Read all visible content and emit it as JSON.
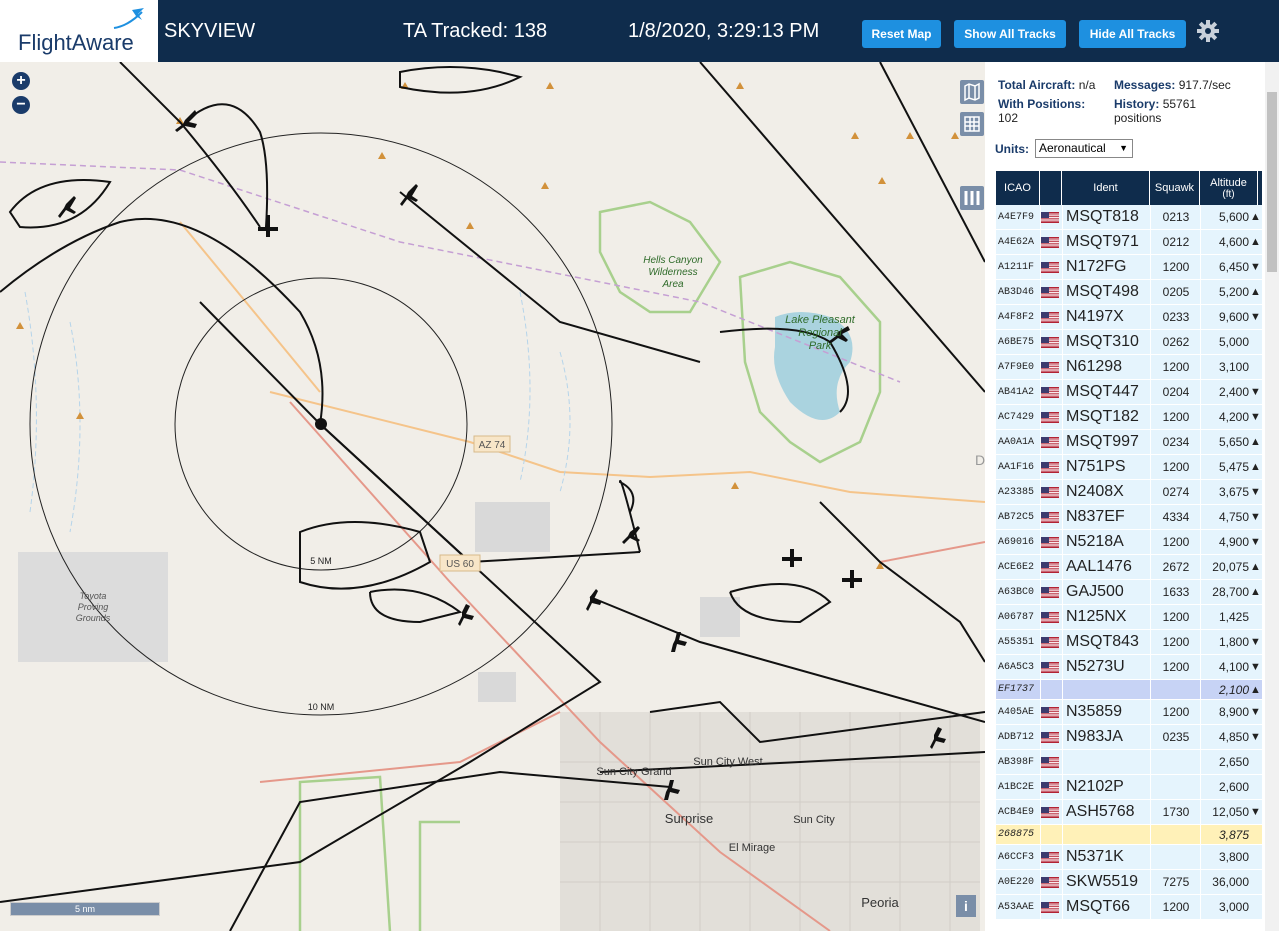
{
  "header": {
    "logo": "FlightAware",
    "title": "SKYVIEW",
    "tracked": "TA Tracked: 138",
    "clock": "1/8/2020, 3:29:13 PM",
    "buttons": {
      "reset": "Reset Map",
      "show_all": "Show All Tracks",
      "hide_all": "Hide All Tracks"
    }
  },
  "map": {
    "labels": {
      "hells_canyon": [
        "Hells Canyon",
        "Wilderness",
        "Area"
      ],
      "lake_pleasant": [
        "Lake Pleasant",
        "Regional",
        "Park"
      ],
      "toyota": [
        "Toyota",
        "Proving",
        "Grounds"
      ],
      "az74": "AZ 74",
      "us60": "US 60",
      "ring5": "5 NM",
      "ring10": "10 NM",
      "sun_city_grand": "Sun City Grand",
      "sun_city_west": "Sun City West",
      "surprise": "Surprise",
      "sun_city": "Sun City",
      "el_mirage": "El Mirage",
      "peoria": "Peoria",
      "d": "D"
    },
    "scale": "5 nm",
    "info": "i"
  },
  "panel": {
    "total_aircraft_label": "Total Aircraft:",
    "total_aircraft_value": "n/a",
    "messages_label": "Messages:",
    "messages_value": "917.7/sec",
    "with_positions_label": "With Positions:",
    "with_positions_value": "102",
    "history_label": "History:",
    "history_value": "55761",
    "history_unit": "positions",
    "units_label": "Units:",
    "units_value": "Aeronautical",
    "columns": {
      "icao": "ICAO",
      "ident": "Ident",
      "squawk": "Squawk",
      "altitude": "Altitude",
      "altitude_unit": "(ft)"
    },
    "rows": [
      {
        "icao": "A4E7F9",
        "ident": "MSQT818",
        "squawk": "0213",
        "alt": "5,600",
        "trend": "▲"
      },
      {
        "icao": "A4E62A",
        "ident": "MSQT971",
        "squawk": "0212",
        "alt": "4,600",
        "trend": "▲"
      },
      {
        "icao": "A1211F",
        "ident": "N172FG",
        "squawk": "1200",
        "alt": "6,450",
        "trend": "▼"
      },
      {
        "icao": "AB3D46",
        "ident": "MSQT498",
        "squawk": "0205",
        "alt": "5,200",
        "trend": "▲"
      },
      {
        "icao": "A4F8F2",
        "ident": "N4197X",
        "squawk": "0233",
        "alt": "9,600",
        "trend": "▼"
      },
      {
        "icao": "A6BE75",
        "ident": "MSQT310",
        "squawk": "0262",
        "alt": "5,000",
        "trend": ""
      },
      {
        "icao": "A7F9E0",
        "ident": "N61298",
        "squawk": "1200",
        "alt": "3,100",
        "trend": ""
      },
      {
        "icao": "AB41A2",
        "ident": "MSQT447",
        "squawk": "0204",
        "alt": "2,400",
        "trend": "▼"
      },
      {
        "icao": "AC7429",
        "ident": "MSQT182",
        "squawk": "1200",
        "alt": "4,200",
        "trend": "▼"
      },
      {
        "icao": "AA0A1A",
        "ident": "MSQT997",
        "squawk": "0234",
        "alt": "5,650",
        "trend": "▲"
      },
      {
        "icao": "AA1F16",
        "ident": "N751PS",
        "squawk": "1200",
        "alt": "5,475",
        "trend": "▲"
      },
      {
        "icao": "A23385",
        "ident": "N2408X",
        "squawk": "0274",
        "alt": "3,675",
        "trend": "▼"
      },
      {
        "icao": "AB72C5",
        "ident": "N837EF",
        "squawk": "4334",
        "alt": "4,750",
        "trend": "▼"
      },
      {
        "icao": "A69016",
        "ident": "N5218A",
        "squawk": "1200",
        "alt": "4,900",
        "trend": "▼"
      },
      {
        "icao": "ACE6E2",
        "ident": "AAL1476",
        "squawk": "2672",
        "alt": "20,075",
        "trend": "▲"
      },
      {
        "icao": "A63BC0",
        "ident": "GAJ500",
        "squawk": "1633",
        "alt": "28,700",
        "trend": "▲"
      },
      {
        "icao": "A06787",
        "ident": "N125NX",
        "squawk": "1200",
        "alt": "1,425",
        "trend": ""
      },
      {
        "icao": "A55351",
        "ident": "MSQT843",
        "squawk": "1200",
        "alt": "1,800",
        "trend": "▼"
      },
      {
        "icao": "A6A5C3",
        "ident": "N5273U",
        "squawk": "1200",
        "alt": "4,100",
        "trend": "▼"
      },
      {
        "icao": "EF1737",
        "ident": "",
        "squawk": "",
        "alt": "2,100",
        "trend": "▲",
        "style": "blue"
      },
      {
        "icao": "A405AE",
        "ident": "N35859",
        "squawk": "1200",
        "alt": "8,900",
        "trend": "▼"
      },
      {
        "icao": "ADB712",
        "ident": "N983JA",
        "squawk": "0235",
        "alt": "4,850",
        "trend": "▼"
      },
      {
        "icao": "AB398F",
        "ident": "",
        "squawk": "",
        "alt": "2,650",
        "trend": ""
      },
      {
        "icao": "A1BC2E",
        "ident": "N2102P",
        "squawk": "",
        "alt": "2,600",
        "trend": ""
      },
      {
        "icao": "ACB4E9",
        "ident": "ASH5768",
        "squawk": "1730",
        "alt": "12,050",
        "trend": "▼"
      },
      {
        "icao": "268875",
        "ident": "",
        "squawk": "",
        "alt": "3,875",
        "trend": "",
        "style": "yellow"
      },
      {
        "icao": "A6CCF3",
        "ident": "N5371K",
        "squawk": "",
        "alt": "3,800",
        "trend": ""
      },
      {
        "icao": "A0E220",
        "ident": "SKW5519",
        "squawk": "7275",
        "alt": "36,000",
        "trend": ""
      },
      {
        "icao": "A53AAE",
        "ident": "MSQT66",
        "squawk": "1200",
        "alt": "3,000",
        "trend": ""
      }
    ]
  }
}
